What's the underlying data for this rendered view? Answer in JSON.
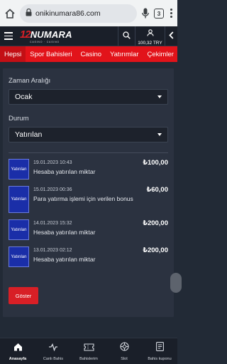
{
  "browser": {
    "url": "onikinumara86.com",
    "tab_count": "3"
  },
  "header": {
    "logo_number": "12",
    "logo_word": "NUMARA",
    "logo_sub": "CASINO · CASINO",
    "balance": "100,32 TRY"
  },
  "nav": {
    "tabs": [
      "Hepsi",
      "Spor Bahisleri",
      "Casino",
      "Yatırımlar",
      "Çekimler"
    ]
  },
  "filters": {
    "date_label": "Zaman Aralığı",
    "date_value": "Ocak",
    "status_label": "Durum",
    "status_value": "Yatırılan"
  },
  "transactions": [
    {
      "badge": "Yatırılan",
      "date": "19.01.2023 10:43",
      "amount": "₺100,00",
      "description": "Hesaba yatırılan miktar"
    },
    {
      "badge": "Yatırılan",
      "date": "15.01.2023 00:36",
      "amount": "₺60,00",
      "description": "Para yatırma işlemi için verilen bonus"
    },
    {
      "badge": "Yatırılan",
      "date": "14.01.2023 15:32",
      "amount": "₺200,00",
      "description": "Hesaba yatırılan miktar"
    },
    {
      "badge": "Yatırılan",
      "date": "13.01.2023 02:12",
      "amount": "₺200,00",
      "description": "Hesaba yatırılan miktar"
    }
  ],
  "actions": {
    "show_label": "Göster"
  },
  "bottom_nav": [
    {
      "label": "Anasayfa",
      "icon": "home-icon"
    },
    {
      "label": "Canlı Bahis",
      "icon": "live-betting-icon"
    },
    {
      "label": "Bahislerim",
      "icon": "ticket-icon"
    },
    {
      "label": "Slot",
      "icon": "slot-icon"
    },
    {
      "label": "Bahis kuponu",
      "icon": "betslip-icon"
    }
  ],
  "colors": {
    "accent": "#e2131a",
    "badge": "#1a2ea8",
    "background": "#222a36",
    "panel": "#2b3240"
  }
}
